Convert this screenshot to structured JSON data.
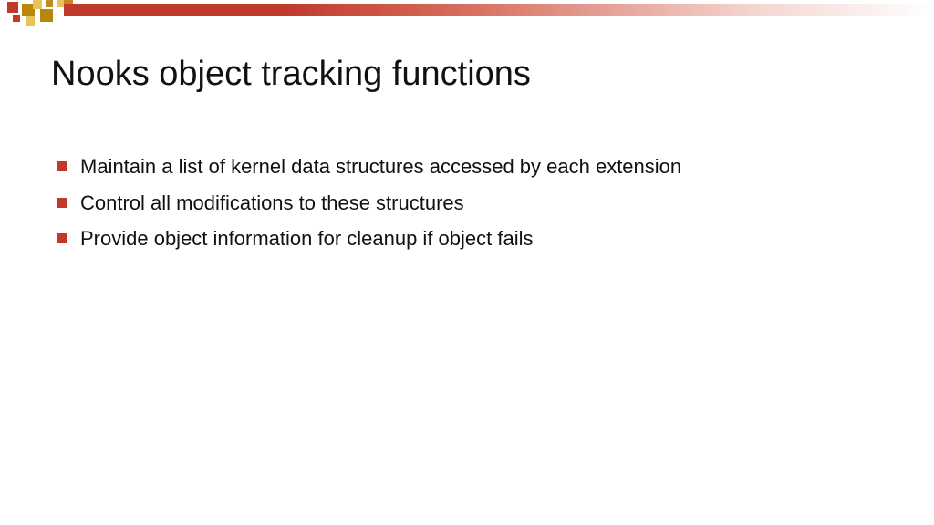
{
  "slide": {
    "title": "Nooks object tracking functions",
    "bullets": [
      "Maintain a list of kernel data structures accessed by each extension",
      "Control all modifications to these structures",
      "Provide object information for cleanup if object fails"
    ]
  },
  "accent": {
    "red": "#c0392b",
    "gold_light": "#e8c35a",
    "gold_dark": "#b8860b"
  }
}
